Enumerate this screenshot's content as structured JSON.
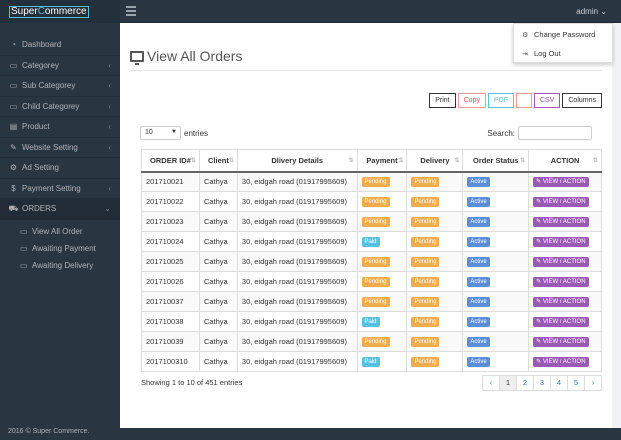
{
  "brand": {
    "part1": "Super",
    "part2": "C",
    "part3": "ommerce"
  },
  "user": "admin",
  "user_menu": [
    {
      "label": "Change Password",
      "icon": "gears-icon"
    },
    {
      "label": "Log Out",
      "icon": "logout-icon"
    }
  ],
  "sidebar": {
    "items": [
      {
        "label": "Dashboard",
        "icon": "dashboard-icon"
      },
      {
        "label": "Categorey",
        "icon": "folder-icon"
      },
      {
        "label": "Sub Categorey",
        "icon": "folder-icon"
      },
      {
        "label": "Child Categorey",
        "icon": "folder-icon"
      },
      {
        "label": "Product",
        "icon": "product-icon"
      },
      {
        "label": "Website Setting",
        "icon": "wrench-icon"
      },
      {
        "label": "Ad Setting",
        "icon": "gear-icon"
      },
      {
        "label": "Payment Setting",
        "icon": "dollar-icon"
      },
      {
        "label": "ORDERS",
        "icon": "cart-icon"
      }
    ],
    "sub": [
      {
        "label": "View All Order"
      },
      {
        "label": "Awaiting Payment"
      },
      {
        "label": "Awaiting Delivery"
      }
    ]
  },
  "footer": "2016 © Super Commerce.",
  "page_title": "View All Orders",
  "buttons": [
    "Print",
    "Copy",
    "PDF",
    "",
    "CSV",
    "Columns"
  ],
  "entries": {
    "value": "10",
    "label": "entries"
  },
  "search_label": "Search:",
  "columns": [
    "ORDER ID#",
    "Client",
    "Dlivery Details",
    "Payment",
    "Delivery",
    "Order Status",
    "ACTION"
  ],
  "rows": [
    {
      "id": "201710021",
      "client": "Cathya",
      "details": "30, eidgah road (01917995609)",
      "payment": "Pending",
      "delivery": "Pending",
      "status": "Active",
      "action": "VIEW / ACTION"
    },
    {
      "id": "201710022",
      "client": "Cathya",
      "details": "30, eidgah road (01917995609)",
      "payment": "Pending",
      "delivery": "Pending",
      "status": "Active",
      "action": "VIEW / ACTION"
    },
    {
      "id": "201710023",
      "client": "Cathya",
      "details": "30, eidgah road (01917995609)",
      "payment": "Pending",
      "delivery": "Pending",
      "status": "Active",
      "action": "VIEW / ACTION"
    },
    {
      "id": "201710024",
      "client": "Cathya",
      "details": "30, eidgah road (01917995609)",
      "payment": "Paid",
      "delivery": "Pending",
      "status": "Active",
      "action": "VIEW / ACTION"
    },
    {
      "id": "201710025",
      "client": "Cathya",
      "details": "30, eidgah road (01917995609)",
      "payment": "Pending",
      "delivery": "Pending",
      "status": "Active",
      "action": "VIEW / ACTION"
    },
    {
      "id": "201710026",
      "client": "Cathya",
      "details": "30, eidgah road (01917995609)",
      "payment": "Pending",
      "delivery": "Pending",
      "status": "Active",
      "action": "VIEW / ACTION"
    },
    {
      "id": "201710037",
      "client": "Cathya",
      "details": "30, eidgah road (01917995609)",
      "payment": "Pending",
      "delivery": "Pending",
      "status": "Active",
      "action": "VIEW / ACTION"
    },
    {
      "id": "201710038",
      "client": "Cathya",
      "details": "30, eidgah road (01917995609)",
      "payment": "Paid",
      "delivery": "Pending",
      "status": "Active",
      "action": "VIEW / ACTION"
    },
    {
      "id": "201710039",
      "client": "Cathya",
      "details": "30, eidgah road (01917995609)",
      "payment": "Pending",
      "delivery": "Pending",
      "status": "Active",
      "action": "VIEW / ACTION"
    },
    {
      "id": "2017100310",
      "client": "Cathya",
      "details": "30, eidgah road (01917995609)",
      "payment": "Paid",
      "delivery": "Pending",
      "status": "Active",
      "action": "VIEW / ACTION"
    }
  ],
  "info": "Showing 1 to 10 of 451 entries",
  "pagination": [
    "‹",
    "1",
    "2",
    "3",
    "4",
    "5",
    "›"
  ],
  "colors": {
    "sidebar": "#2a3542",
    "pending": "#f0ad4e",
    "paid": "#5bc0de",
    "active": "#5b8dd9",
    "action": "#9b59b6"
  }
}
